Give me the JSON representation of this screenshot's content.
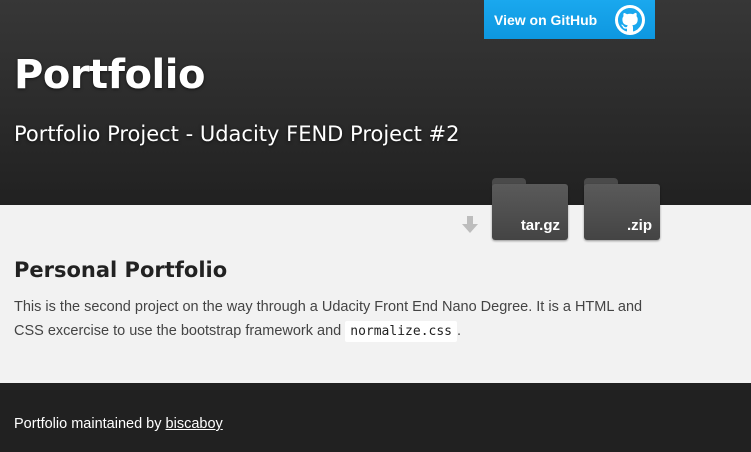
{
  "header": {
    "github_button_label": "View on GitHub",
    "github_icon": "github-octocat-icon",
    "title": "Portfolio",
    "tagline": "Portfolio Project - Udacity FEND Project #2"
  },
  "downloads": {
    "arrow_icon": "download-arrow-icon",
    "tar_label": "tar.gz",
    "zip_label": ".zip"
  },
  "main": {
    "heading": "Personal Portfolio",
    "text_before_code": "This is the second project on the way through a Udacity Front End Nano Degree. It is a HTML and CSS excercise to use the bootstrap framework and ",
    "code": "normalize.css",
    "text_after_code": "."
  },
  "footer": {
    "text_prefix": "Portfolio maintained by ",
    "author_link": "biscaboy"
  },
  "colors": {
    "header_bg": "#212121",
    "github_button": "#1aa8ee",
    "page_bg": "#f2f2f2",
    "footer_bg": "#212121"
  }
}
